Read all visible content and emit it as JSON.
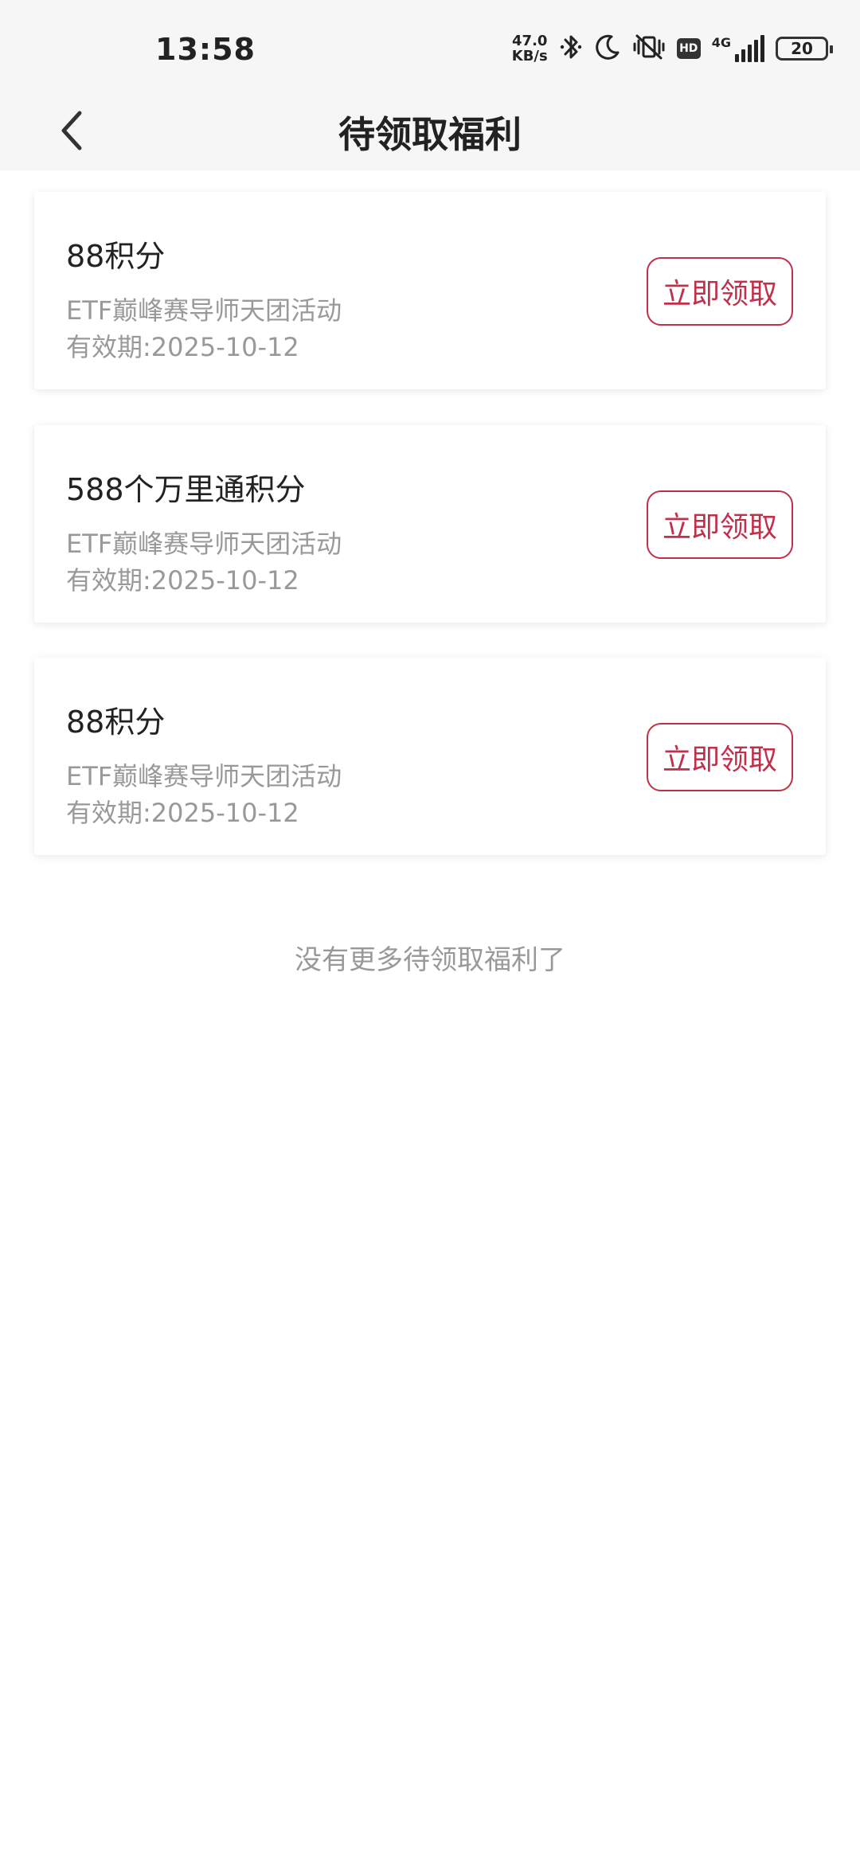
{
  "status_bar": {
    "time": "13:58",
    "net_speed_value": "47.0",
    "net_speed_unit": "KB/s",
    "hd_label": "HD",
    "network_label": "4G",
    "battery_level": "20"
  },
  "header": {
    "title": "待领取福利"
  },
  "rewards": [
    {
      "title": "88积分",
      "description": "ETF巅峰赛导师天团活动",
      "expiry": "有效期:2025-10-12",
      "button_label": "立即领取"
    },
    {
      "title": "588个万里通积分",
      "description": "ETF巅峰赛导师天团活动",
      "expiry": "有效期:2025-10-12",
      "button_label": "立即领取"
    },
    {
      "title": "88积分",
      "description": "ETF巅峰赛导师天团活动",
      "expiry": "有效期:2025-10-12",
      "button_label": "立即领取"
    }
  ],
  "footer_text": "没有更多待领取福利了",
  "colors": {
    "accent": "#c0304a",
    "header_bg": "#f6f6f6",
    "muted_text": "#999999"
  }
}
